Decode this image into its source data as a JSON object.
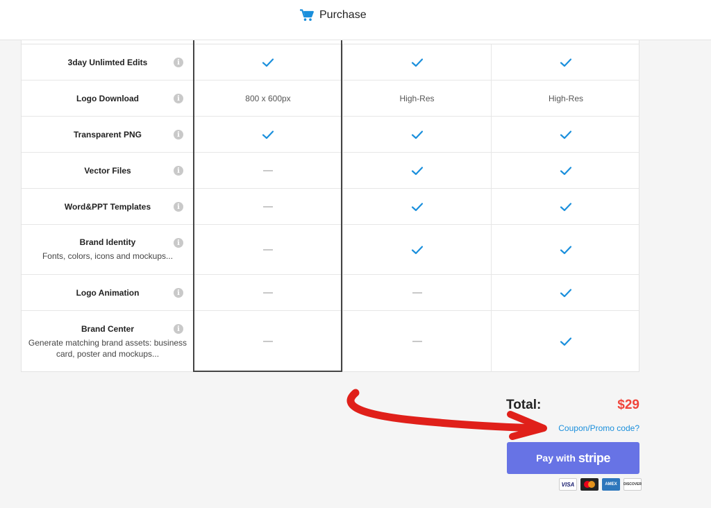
{
  "header": {
    "title": "Purchase",
    "icon": "cart-icon"
  },
  "features": [
    {
      "name": "3day Unlimted Edits",
      "desc": "",
      "values": [
        "check",
        "check",
        "check"
      ]
    },
    {
      "name": "Logo Download",
      "desc": "",
      "values": [
        "800 x 600px",
        "High-Res",
        "High-Res"
      ]
    },
    {
      "name": "Transparent PNG",
      "desc": "",
      "values": [
        "check",
        "check",
        "check"
      ]
    },
    {
      "name": "Vector Files",
      "desc": "",
      "values": [
        "dash",
        "check",
        "check"
      ]
    },
    {
      "name": "Word&PPT Templates",
      "desc": "",
      "values": [
        "dash",
        "check",
        "check"
      ]
    },
    {
      "name": "Brand Identity",
      "desc": "Fonts, colors, icons and mockups...",
      "values": [
        "dash",
        "check",
        "check"
      ]
    },
    {
      "name": "Logo Animation",
      "desc": "",
      "values": [
        "dash",
        "dash",
        "check"
      ]
    },
    {
      "name": "Brand Center",
      "desc": "Generate matching brand assets: business card, poster and mockups...",
      "values": [
        "dash",
        "dash",
        "check"
      ]
    }
  ],
  "summary": {
    "total_label": "Total:",
    "total_value": "$29",
    "coupon_link": "Coupon/Promo code?",
    "pay_button_prefix": "Pay with",
    "pay_button_brand": "stripe"
  },
  "payment_cards": [
    "VISA",
    "mastercard",
    "AMEX",
    "DISCOVER"
  ],
  "colors": {
    "check": "#1a8fdc",
    "total": "#f0443a",
    "stripe_button": "#6773e5",
    "annotation_arrow": "#e0201a",
    "selected_column_border": "#444444"
  }
}
